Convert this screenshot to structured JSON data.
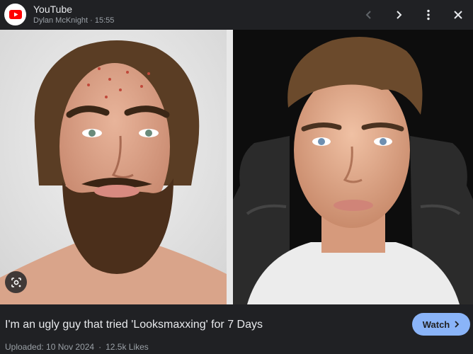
{
  "header": {
    "source": "YouTube",
    "author": "Dylan McKnight",
    "time": "15:55",
    "separator": "·",
    "icons": [
      "youtube-logo-icon",
      "chevron-left-icon",
      "chevron-right-icon",
      "more-vert-icon",
      "close-icon"
    ]
  },
  "content": {
    "left_image": "before photo of bearded man with long hair",
    "right_image": "after photo of clean-shaven man",
    "lens_icon": "google-lens-icon"
  },
  "footer": {
    "title": "I'm an ugly guy that tried 'Looksmaxxing' for 7 Days",
    "uploaded": "Uploaded: 10 Nov 2024",
    "dot": "·",
    "likes": "12.5k Likes",
    "watch_label": "Watch"
  },
  "colors": {
    "header_bg": "#202124",
    "accent": "#8ab4f8",
    "youtube_red": "#ff0000"
  }
}
